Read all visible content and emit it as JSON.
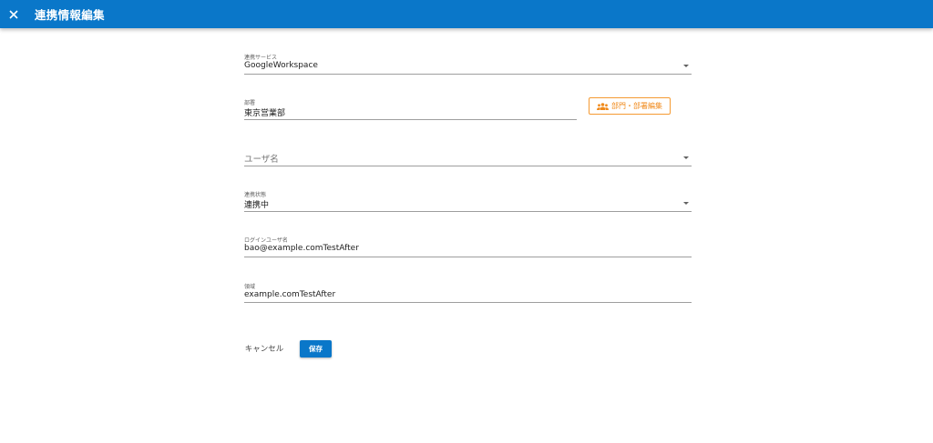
{
  "header": {
    "title": "連携情報編集",
    "close_icon": "close-icon",
    "bg_color": "#0a77c9"
  },
  "form": {
    "service": {
      "label": "連携サービス",
      "value": "GoogleWorkspace"
    },
    "department": {
      "label": "部署",
      "value": "東京営業部"
    },
    "dept_edit_button": {
      "label": "部門・部署編集",
      "icon": "group-icon",
      "color": "#f08a1c"
    },
    "username": {
      "placeholder": "ユーザ名"
    },
    "status": {
      "label": "連携状態",
      "value": "連携中"
    },
    "login_username": {
      "label": "ログインユーザ名",
      "value": "bao@example.comTestAfter"
    },
    "domain": {
      "label": "領域",
      "value": "example.comTestAfter"
    }
  },
  "actions": {
    "cancel_label": "キャンセル",
    "save_label": "保存"
  }
}
